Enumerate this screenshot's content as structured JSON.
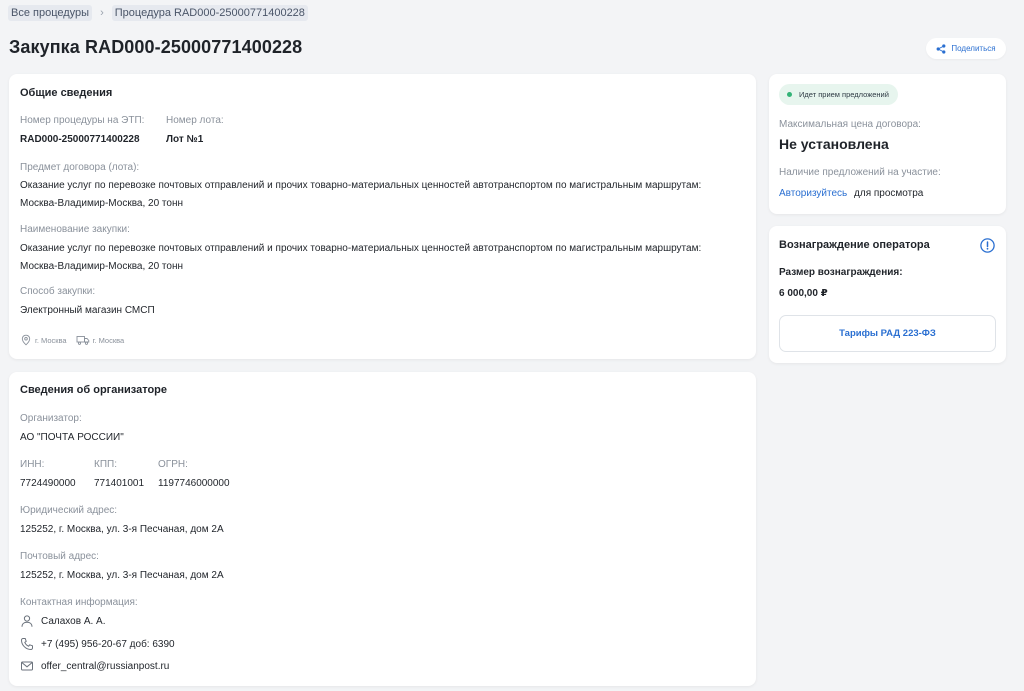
{
  "breadcrumb": {
    "items": [
      "Все процедуры",
      "Процедура RAD000-25000771400228"
    ],
    "separator": "›"
  },
  "page": {
    "title": "Закупка RAD000-25000771400228",
    "share_label": "Поделиться"
  },
  "general": {
    "title": "Общие сведения",
    "procedure_number_label": "Номер процедуры на ЭТП:",
    "procedure_number": "RAD000-25000771400228",
    "lot_number_label": "Номер лота:",
    "lot_number": "Лот №1",
    "subject_label": "Предмет договора (лота):",
    "subject": "Оказание услуг по перевозке почтовых отправлений и прочих товарно-материальных ценностей автотранспортом по магистральным маршрутам: Москва-Владимир-Москва, 20 тонн",
    "purchase_name_label": "Наименование закупки:",
    "purchase_name": "Оказание услуг по перевозке почтовых отправлений и прочих товарно-материальных ценностей автотранспортом по магистральным маршрутам: Москва-Владимир-Москва, 20 тонн",
    "method_label": "Способ закупки:",
    "method": "Электронный магазин СМСП",
    "location_1": "г. Москва",
    "location_2": "г. Москва"
  },
  "organizer": {
    "title": "Сведения об организаторе",
    "org_label": "Организатор:",
    "org": "АО \"ПОЧТА РОССИИ\"",
    "inn_label": "ИНН:",
    "inn": "7724490000",
    "kpp_label": "КПП:",
    "kpp": "771401001",
    "ogrn_label": "ОГРН:",
    "ogrn": "1197746000000",
    "legal_address_label": "Юридический адрес:",
    "legal_address": "125252, г. Москва, ул. 3-я Песчаная, дом 2А",
    "postal_address_label": "Почтовый адрес:",
    "postal_address": "125252, г. Москва, ул. 3-я Песчаная, дом 2А",
    "contact_label": "Контактная информация:",
    "contact_person": "Салахов А. А.",
    "contact_phone": "+7 (495) 956-20-67 доб: 6390",
    "contact_email": "offer_central@russianpost.ru"
  },
  "status": {
    "badge": "Идет прием предложений",
    "max_price_label": "Максимальная цена договора:",
    "max_price": "Не установлена",
    "offers_label": "Наличие предложений на участие:",
    "auth_link": "Авторизуйтесь",
    "auth_suffix": "для просмотра"
  },
  "reward": {
    "title": "Вознаграждение оператора",
    "size_label": "Размер вознаграждения:",
    "size": "6 000,00 ₽",
    "tariff_button": "Тарифы РАД 223-ФЗ"
  },
  "colors": {
    "accent": "#2a6fd1",
    "status_green": "#33b377",
    "background": "#f3f4f6"
  }
}
